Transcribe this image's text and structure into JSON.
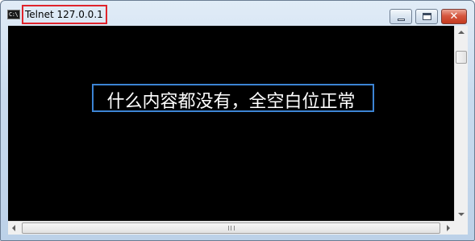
{
  "window": {
    "title": "Telnet 127.0.0.1",
    "icon": "console-icon",
    "icon_text": "C:\\"
  },
  "controls": {
    "minimize_icon": "minimize-icon",
    "maximize_icon": "maximize-icon",
    "close_icon": "close-icon",
    "close_glyph": "✕"
  },
  "console": {
    "text": "什么内容都没有，全空白位正常",
    "background": "#000000",
    "foreground": "#ffffff"
  },
  "highlights": {
    "title_box_color": "#e0242c",
    "text_box_color": "#3c84d4"
  }
}
